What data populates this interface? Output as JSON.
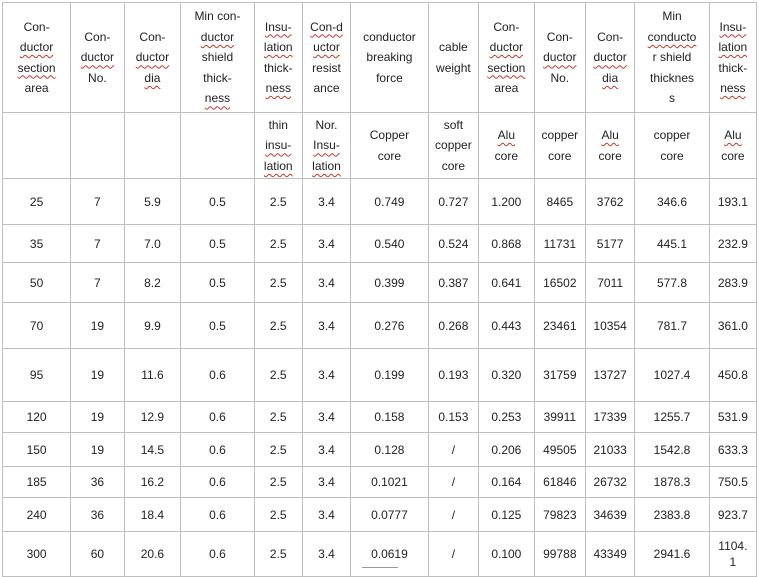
{
  "header_row_1": [
    [
      "Con-",
      "ductor",
      "section",
      "area"
    ],
    [
      "Con-",
      "ductor",
      "No."
    ],
    [
      "Con-",
      "ductor",
      "dia"
    ],
    [
      "Min con-",
      "ductor",
      "shield",
      "thick-",
      "ness"
    ],
    [
      "Insu-",
      "lation",
      "thick-",
      "ness"
    ],
    [
      "Con-d",
      "uctor",
      "resist",
      "ance"
    ],
    [
      "conductor",
      "breaking",
      "force"
    ],
    [
      "cable",
      "weight"
    ],
    [
      "Con-",
      "ductor",
      "section",
      "area"
    ],
    [
      "Con-",
      "ductor",
      "No."
    ],
    [
      "Con-",
      "ductor",
      "dia"
    ],
    [
      "Min",
      "conducto",
      "r shield",
      "thicknes",
      "s"
    ],
    [
      "Insu-",
      "lation",
      "thick-",
      "ness"
    ]
  ],
  "header_row_2": [
    [],
    [],
    [],
    [],
    [
      "thin",
      "insu-",
      "lation"
    ],
    [
      "Nor.",
      "Insu-",
      "lation"
    ],
    [
      "Copper",
      "core"
    ],
    [
      "soft",
      "copper",
      "core"
    ],
    [
      "Alu",
      "core"
    ],
    [
      "copper",
      "core"
    ],
    [
      "Alu",
      "core"
    ],
    [
      "copper",
      "core"
    ],
    [
      "Alu",
      "core"
    ]
  ],
  "rows": [
    [
      "25",
      "7",
      "5.9",
      "0.5",
      "2.5",
      "3.4",
      "0.749",
      "0.727",
      "1.200",
      "8465",
      "3762",
      "346.6",
      "193.1"
    ],
    [
      "35",
      "7",
      "7.0",
      "0.5",
      "2.5",
      "3.4",
      "0.540",
      "0.524",
      "0.868",
      "11731",
      "5177",
      "445.1",
      "232.9"
    ],
    [
      "50",
      "7",
      "8.2",
      "0.5",
      "2.5",
      "3.4",
      "0.399",
      "0.387",
      "0.641",
      "16502",
      "7011",
      "577.8",
      "283.9"
    ],
    [
      "70",
      "19",
      "9.9",
      "0.5",
      "2.5",
      "3.4",
      "0.276",
      "0.268",
      "0.443",
      "23461",
      "10354",
      "781.7",
      "361.0"
    ],
    [
      "95",
      "19",
      "11.6",
      "0.6",
      "2.5",
      "3.4",
      "0.199",
      "0.193",
      "0.320",
      "31759",
      "13727",
      "1027.4",
      "450.8"
    ],
    [
      "120",
      "19",
      "12.9",
      "0.6",
      "2.5",
      "3.4",
      "0.158",
      "0.153",
      "0.253",
      "39911",
      "17339",
      "1255.7",
      "531.9"
    ],
    [
      "150",
      "19",
      "14.5",
      "0.6",
      "2.5",
      "3.4",
      "0.128",
      "/",
      "0.206",
      "49505",
      "21033",
      "1542.8",
      "633.3"
    ],
    [
      "185",
      "36",
      "16.2",
      "0.6",
      "2.5",
      "3.4",
      "0.1021",
      "/",
      "0.164",
      "61846",
      "26732",
      "1878.3",
      "750.5"
    ],
    [
      "240",
      "36",
      "18.4",
      "0.6",
      "2.5",
      "3.4",
      "0.0777",
      "/",
      "0.125",
      "79823",
      "34639",
      "2383.8",
      "923.7"
    ],
    [
      "300",
      "60",
      "20.6",
      "0.6",
      "2.5",
      "3.4",
      "0.0619",
      "/",
      "0.100",
      "99788",
      "43349",
      "2941.6",
      [
        "1104.",
        "1"
      ]
    ]
  ],
  "spell_underlined": [
    "ductor",
    "dia",
    "lation",
    "ness",
    "Con-d",
    "uctor",
    "Insu-",
    "insu-",
    "Alu",
    "conducto",
    "section"
  ]
}
